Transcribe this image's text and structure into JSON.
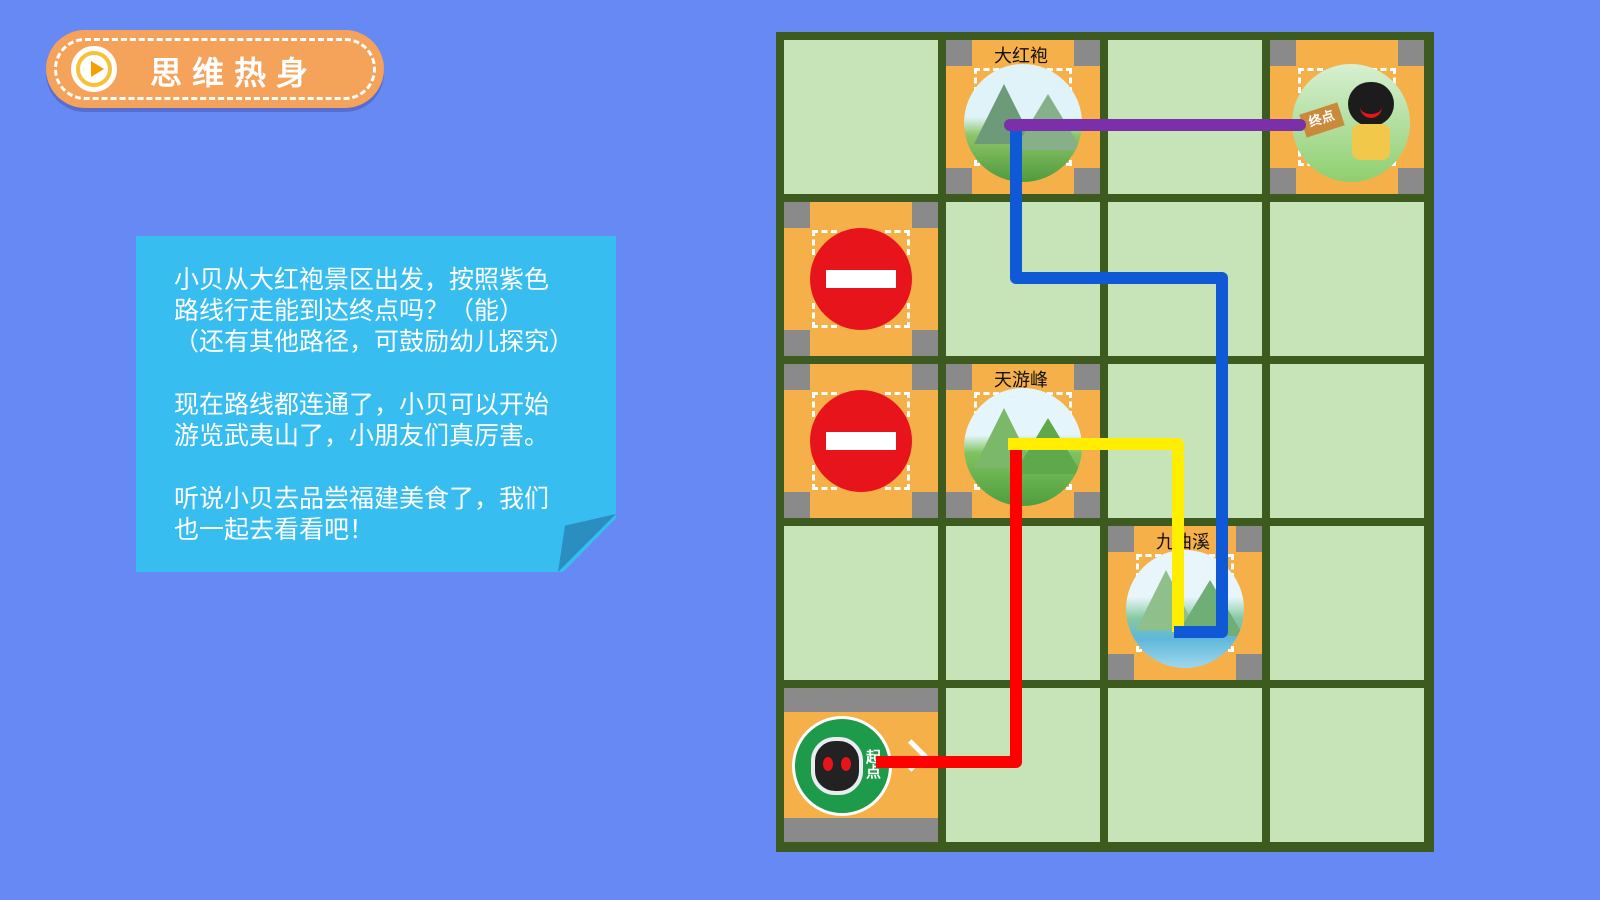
{
  "header": {
    "title": "思维热身"
  },
  "note": {
    "paragraphs": [
      [
        "小贝从大红袍景区出发，按照紫色",
        "路线行走能到达终点吗？（能）",
        "（还有其他路径，可鼓励幼儿探究）"
      ],
      [
        "现在路线都连通了，小贝可以开始",
        "游览武夷山了，小朋友们真厉害。"
      ],
      [
        "听说小贝去品尝福建美食了，我们",
        "也一起去看看吧！"
      ]
    ]
  },
  "board": {
    "scenic_labels": {
      "dahongpao": "大红袍",
      "tianyoufeng": "天游峰",
      "jiuquxi": "九曲溪"
    },
    "start_text": "起点",
    "end_text": "终点"
  },
  "routes": [
    {
      "color": "#7b2fa8",
      "name": "purple"
    },
    {
      "color": "#0f58d6",
      "name": "blue"
    },
    {
      "color": "#ffee00",
      "name": "yellow"
    },
    {
      "color": "#ff0000",
      "name": "red"
    }
  ]
}
